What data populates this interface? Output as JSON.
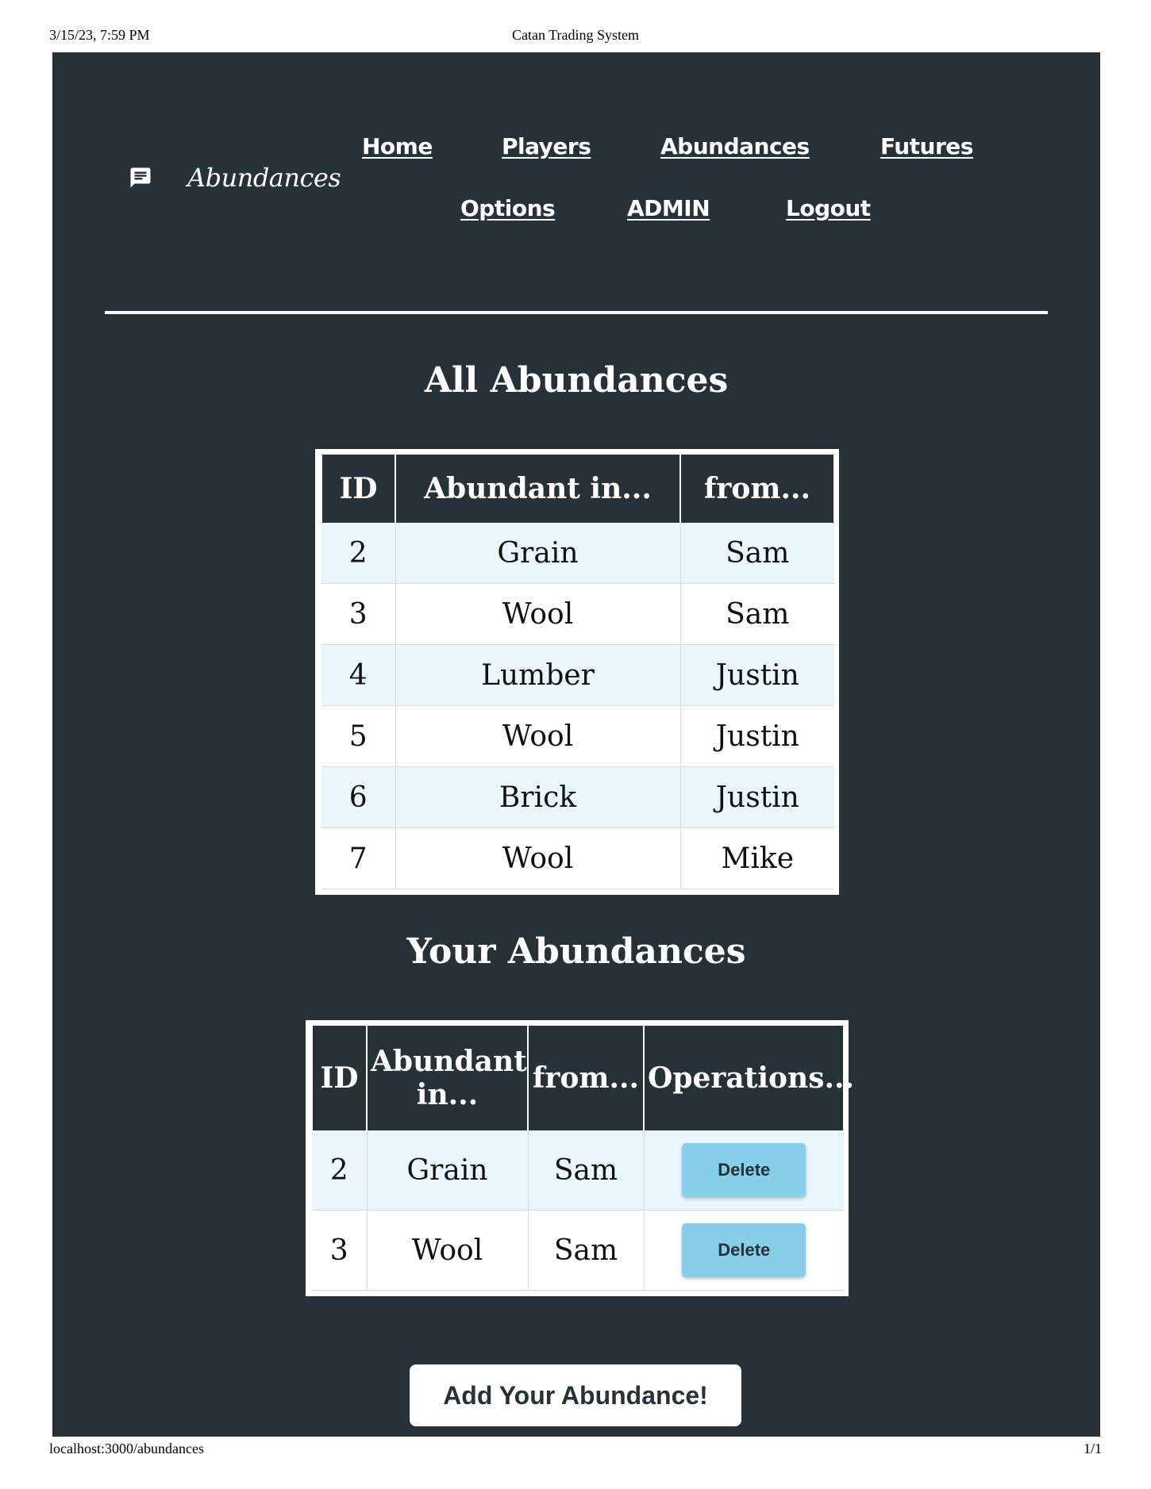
{
  "print": {
    "datetime": "3/15/23, 7:59 PM",
    "doc_title": "Catan Trading System",
    "url": "localhost:3000/abundances",
    "page_count": "1/1"
  },
  "brand": {
    "icon": "message-icon",
    "title": "Abundances"
  },
  "nav": {
    "home": "Home",
    "players": "Players",
    "abundances": "Abundances",
    "futures": "Futures",
    "options": "Options",
    "admin": "ADMIN",
    "logout": "Logout"
  },
  "all_abundances": {
    "title": "All Abundances",
    "headers": [
      "ID",
      "Abundant in...",
      "from..."
    ],
    "rows": [
      [
        "2",
        "Grain",
        "Sam"
      ],
      [
        "3",
        "Wool",
        "Sam"
      ],
      [
        "4",
        "Lumber",
        "Justin"
      ],
      [
        "5",
        "Wool",
        "Justin"
      ],
      [
        "6",
        "Brick",
        "Justin"
      ],
      [
        "7",
        "Wool",
        "Mike"
      ]
    ]
  },
  "your_abundances": {
    "title": "Your Abundances",
    "headers": [
      "ID",
      "Abundant in...",
      "from...",
      "Operations..."
    ],
    "rows": [
      [
        "2",
        "Grain",
        "Sam"
      ],
      [
        "3",
        "Wool",
        "Sam"
      ]
    ],
    "delete_label": "Delete"
  },
  "add_button": "Add Your Abundance!",
  "colors": {
    "page_bg": "#263238",
    "row_alt": "#eaf6fd",
    "delete_button": "#87ceeb"
  }
}
